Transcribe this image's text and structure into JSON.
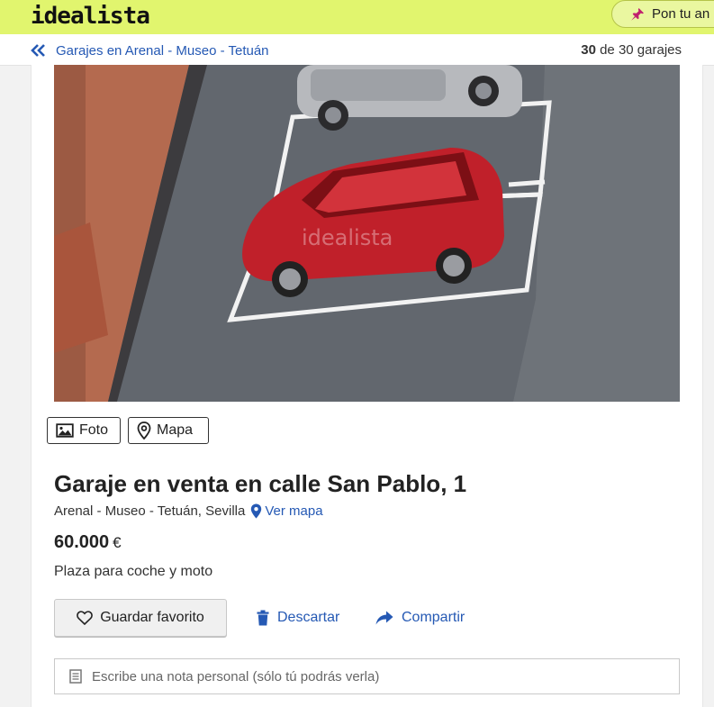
{
  "header": {
    "logo": "idealista",
    "publish_label": "Pon tu an"
  },
  "subnav": {
    "back_label": "Garajes en Arenal - Museo - Tetuán",
    "counter_current": "30",
    "counter_rest": "de 30 garajes"
  },
  "photo": {
    "watermark": "idealista"
  },
  "media_tabs": {
    "photo_label": "Foto",
    "map_label": "Mapa"
  },
  "listing": {
    "title": "Garaje en venta en calle San Pablo, 1",
    "location": "Arenal - Museo - Tetuán, Sevilla",
    "map_link": "Ver mapa",
    "price": "60.000",
    "currency": "€",
    "description": "Plaza para coche y moto"
  },
  "actions": {
    "favorite_label": "Guardar favorito",
    "discard_label": "Descartar",
    "share_label": "Compartir"
  },
  "note": {
    "placeholder": "Escribe una nota personal (sólo tú podrás verla)"
  },
  "colors": {
    "brand_bar": "#e1f56e",
    "link": "#2559b4",
    "car": "#c0202a"
  }
}
